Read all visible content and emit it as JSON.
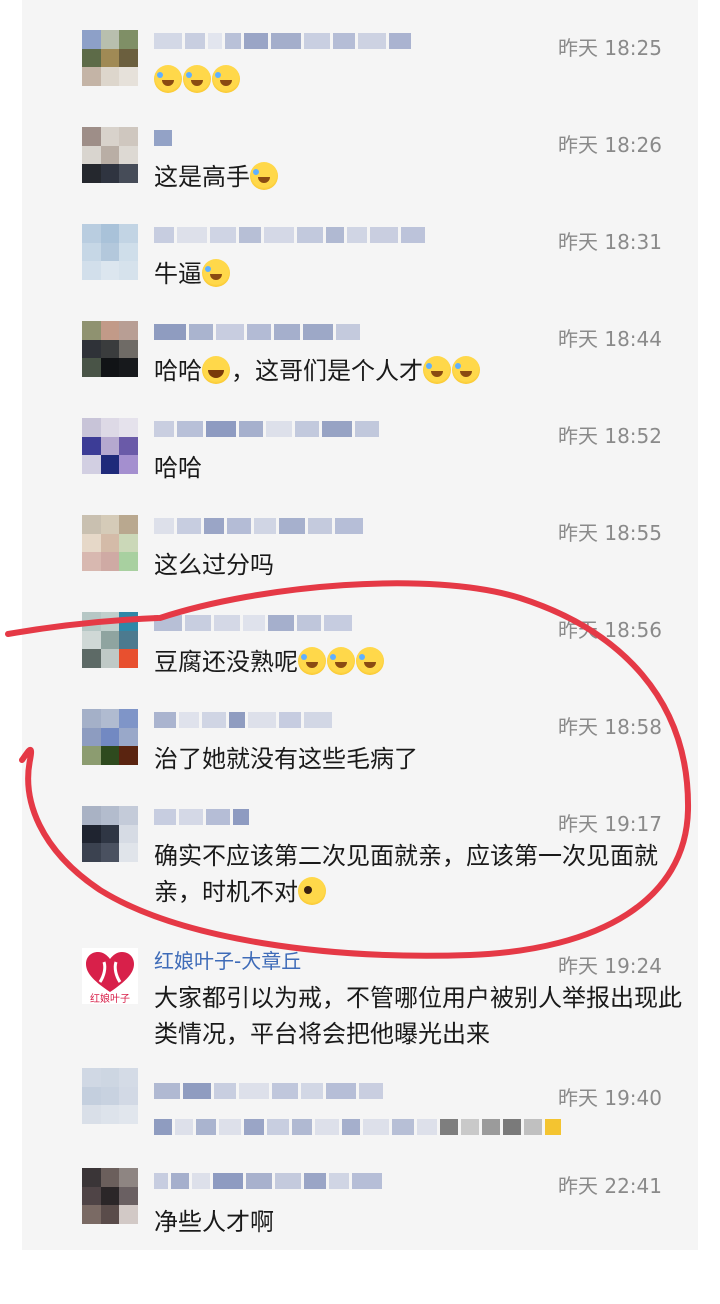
{
  "messages": [
    {
      "time": "昨天 18:25",
      "text": "",
      "emojis": [
        "laugh",
        "laugh",
        "laugh"
      ]
    },
    {
      "time": "昨天 18:26",
      "text": "这是高手",
      "emojis": [
        "laugh"
      ]
    },
    {
      "time": "昨天 18:31",
      "text": "牛逼",
      "emojis": [
        "laugh"
      ]
    },
    {
      "time": "昨天 18:44",
      "text": "哈哈",
      "mid": "，这哥们是个人才",
      "emojis": [
        "smile"
      ],
      "end_emojis": [
        "laugh",
        "laugh"
      ]
    },
    {
      "time": "昨天 18:52",
      "text": "哈哈",
      "emojis": []
    },
    {
      "time": "昨天 18:55",
      "text": "这么过分吗",
      "emojis": []
    },
    {
      "time": "昨天 18:56",
      "text": "豆腐还没熟呢",
      "emojis": [
        "laugh",
        "laugh",
        "laugh"
      ]
    },
    {
      "time": "昨天 18:58",
      "text": "治了她就没有这些毛病了",
      "emojis": []
    },
    {
      "time": "昨天 19:17",
      "text": "确实不应该第二次见面就亲，应该第一次见面就亲，时机不对",
      "emojis": [
        "wink"
      ]
    },
    {
      "time": "昨天 19:24",
      "name": "红娘叶子-大章丘",
      "avatar_label": "红娘叶子",
      "text": "大家都引以为戒，不管哪位用户被别人举报出现此类情况，平台将会把他曝光出来",
      "emojis": []
    },
    {
      "time": "昨天 19:40",
      "text": "",
      "emojis": []
    },
    {
      "time": "昨天 22:41",
      "text": "净些人才啊",
      "emojis": []
    }
  ],
  "colors": {
    "panel_bg": "#f5f5f5",
    "time_color": "#8a8a8a",
    "name_color": "#3e6bb8",
    "annotation_red": "#e53946"
  }
}
